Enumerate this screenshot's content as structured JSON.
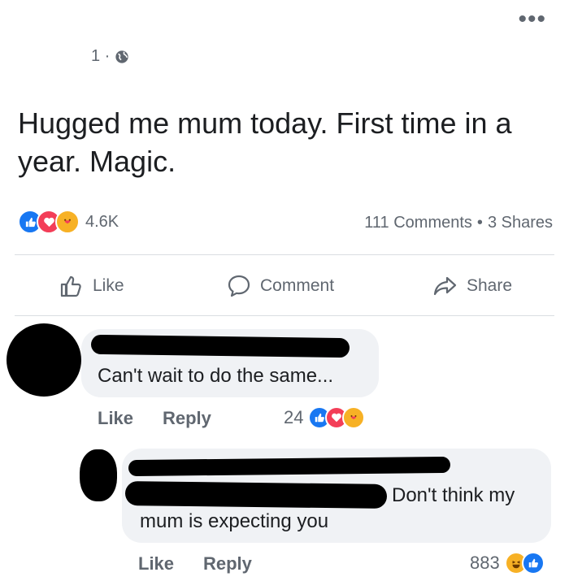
{
  "post": {
    "meta_suffix": "1 ·",
    "text": "Hugged me mum today. First time in a year. Magic.",
    "reaction_count": "4.6K",
    "comments_count": "111 Comments",
    "separator": "•",
    "shares_count": "3 Shares"
  },
  "actions": {
    "like": "Like",
    "comment": "Comment",
    "share": "Share"
  },
  "comments": [
    {
      "text": "Can't wait to do the same...",
      "like_label": "Like",
      "reply_label": "Reply",
      "reaction_count": "24"
    },
    {
      "text_line1": "Don't think my",
      "text_line2": "mum is expecting you",
      "like_label": "Like",
      "reply_label": "Reply",
      "reaction_count": "883"
    }
  ],
  "colors": {
    "like": "#1877f2",
    "love": "#f33e58",
    "care": "#f7b125",
    "muted": "#606770",
    "bubble": "#f0f2f5"
  }
}
